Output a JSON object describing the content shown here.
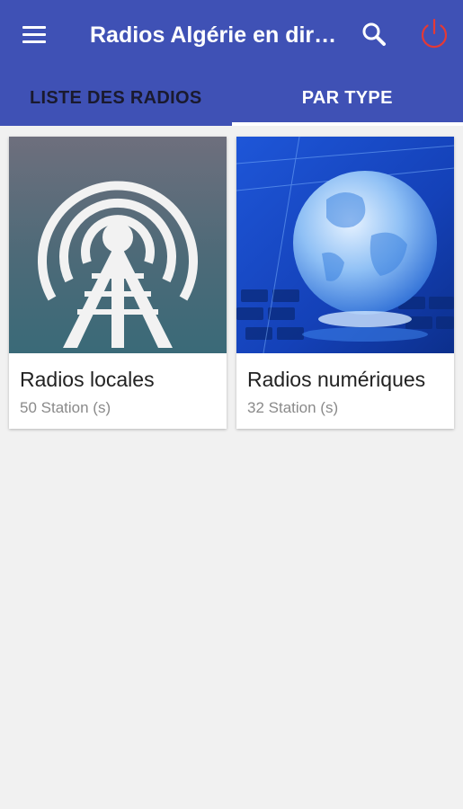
{
  "app": {
    "title": "Radios Algérie en direct",
    "primary_color": "#3f51b5",
    "accent_color": "#e53935",
    "icons": {
      "menu": "menu-icon",
      "search": "search-icon",
      "power": "power-icon"
    }
  },
  "tabs": [
    {
      "label": "LISTE DES RADIOS",
      "active": false
    },
    {
      "label": "PAR TYPE",
      "active": true
    }
  ],
  "categories": [
    {
      "title": "Radios locales",
      "count": "50 Station (s)",
      "image": "radio-tower-image"
    },
    {
      "title": "Radios numériques",
      "count": "32 Station (s)",
      "image": "digital-globe-image"
    }
  ]
}
